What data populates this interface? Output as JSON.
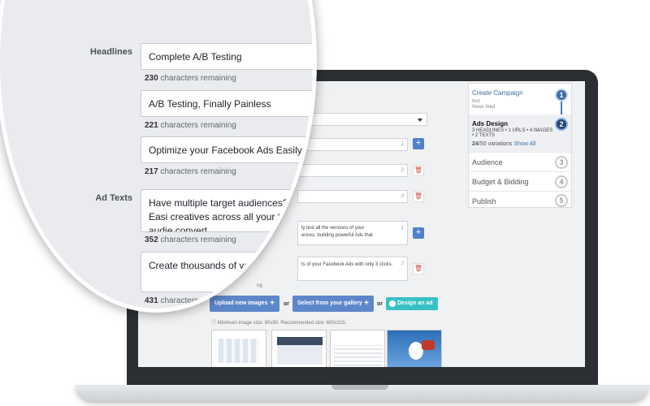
{
  "steps": [
    {
      "label": "Create Campaign",
      "sub": "test",
      "sub2": "News feed",
      "num": "1"
    },
    {
      "label": "Ads Design",
      "detail": "3 HEADLINES • 1 URLS • 4 IMAGES • 2 TEXTS",
      "variations_count": "24",
      "variations_rest": "/50 variations",
      "show_all": "Show All",
      "num": "2"
    },
    {
      "label": "Audience",
      "num": "3"
    },
    {
      "label": "Budget & Bidding",
      "num": "4"
    },
    {
      "label": "Publish",
      "num": "5"
    }
  ],
  "screen_form": {
    "fields": [
      {
        "num": "1"
      },
      {
        "num": "2"
      },
      {
        "num": "3"
      },
      {
        "text": "ly test all the versions of your\nences, building powerful Ads that",
        "num": "1"
      },
      {
        "text": "ts of your Facebook Ads with only 3 clicks.",
        "num": "2"
      }
    ],
    "buttons": {
      "upload": "Upload new images",
      "gallery": "Select from your gallery",
      "design": "Design an ad",
      "or": "or",
      "plus": "+"
    },
    "min_size_note": "Minimum image size: 90x90. Recommended size: 600x315.",
    "images_remaining_fragment": "ng"
  },
  "magnifier": {
    "headlines_label": "Headlines",
    "ad_texts_label": "Ad Texts",
    "headlines": [
      {
        "text": "Complete A/B Testing",
        "remaining": "230",
        "remaining_label": "characters remaining"
      },
      {
        "text": "A/B Testing, Finally Painless",
        "remaining": "221",
        "remaining_label": "characters remaining"
      },
      {
        "text": "Optimize your Facebook Ads Easily",
        "remaining": "217",
        "remaining_label": "characters remaining"
      }
    ],
    "ad_texts": [
      {
        "text": "Have multiple target audiences? Easi creatives across all your target audie convert",
        "remaining": "352",
        "remaining_label": "characters remaining"
      },
      {
        "text": "Create thousands of variants",
        "remaining": "431",
        "remaining_label": "characters remaining"
      }
    ]
  },
  "colors": {
    "accent_blue": "#3b6ea5",
    "button_blue": "#5d87c8",
    "design_teal": "#37c1c4",
    "danger_red": "#d9534f"
  }
}
